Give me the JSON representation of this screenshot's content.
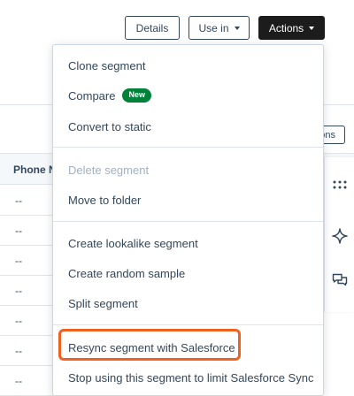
{
  "toolbar": {
    "details_label": "Details",
    "use_in_label": "Use in",
    "actions_label": "Actions"
  },
  "table": {
    "column_header": "Phone N",
    "options_label": "Options",
    "rows": [
      "--",
      "--",
      "--",
      "--",
      "--",
      "--",
      "--"
    ]
  },
  "actions_menu": {
    "clone": "Clone segment",
    "compare": "Compare",
    "compare_badge": "New",
    "convert": "Convert to static",
    "delete": "Delete segment",
    "move": "Move to folder",
    "lookalike": "Create lookalike segment",
    "random_sample": "Create random sample",
    "split": "Split segment",
    "resync": "Resync segment with Salesforce",
    "stop_sync": "Stop using this segment to limit Salesforce Sync"
  },
  "side_rail": {
    "icons": [
      "grid-dots-icon",
      "sparkle-icon",
      "chat-icon"
    ]
  },
  "colors": {
    "primary_text": "#33475b",
    "actions_button_bg": "#1c1c1c",
    "new_badge_bg": "#00823a",
    "highlight": "#f0601f",
    "disabled_text": "#a2b0bf"
  }
}
